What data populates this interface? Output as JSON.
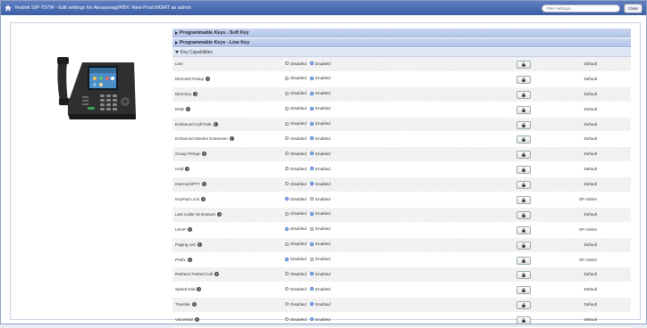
{
  "header": {
    "title": "Yealink SIP-T57W - Edit settings for Akrayanagi/PBX: New Prod MGMT as admin",
    "filter_placeholder": "Filter settings...",
    "clear_label": "Clear"
  },
  "sections": {
    "soft_key": "Programmable Keys - Soft Key",
    "line_key": "Programmable Keys - Line Key",
    "key_capabilities": "Key Capabilities"
  },
  "radio_labels": {
    "disabled": "Disabled",
    "enabled": "Enabled"
  },
  "rows": [
    {
      "name": "Line",
      "help": false,
      "selected": "enabled",
      "value": "Default"
    },
    {
      "name": "Directed Pickup",
      "help": true,
      "selected": "enabled",
      "value": "Default"
    },
    {
      "name": "Directory",
      "help": true,
      "selected": "enabled",
      "value": "Default"
    },
    {
      "name": "DND",
      "help": true,
      "selected": "enabled",
      "value": "Default"
    },
    {
      "name": "Enhanced Call Park",
      "help": true,
      "selected": "enabled",
      "value": "Default"
    },
    {
      "name": "Enhanced Monitor Extension",
      "help": true,
      "selected": "enabled",
      "value": "Default"
    },
    {
      "name": "Group Pickup",
      "help": true,
      "selected": "enabled",
      "value": "Default"
    },
    {
      "name": "Hold",
      "help": true,
      "selected": "enabled",
      "value": "Default"
    },
    {
      "name": "Intercom/PTT",
      "help": true,
      "selected": "enabled",
      "value": "Default"
    },
    {
      "name": "KeyPad Lock",
      "help": true,
      "selected": "disabled",
      "value": "SP Admin"
    },
    {
      "name": "Last Caller ID Erasure",
      "help": true,
      "selected": "enabled",
      "value": "Default"
    },
    {
      "name": "LDAP",
      "help": true,
      "selected": "disabled",
      "value": "SP Admin"
    },
    {
      "name": "Paging List",
      "help": true,
      "selected": "enabled",
      "value": "Default"
    },
    {
      "name": "Prefix",
      "help": true,
      "selected": "disabled",
      "value": "SP Admin"
    },
    {
      "name": "Retrieve Parked Call",
      "help": true,
      "selected": "enabled",
      "value": "Default"
    },
    {
      "name": "Speed Dial",
      "help": true,
      "selected": "enabled",
      "value": "Default"
    },
    {
      "name": "Transfer",
      "help": true,
      "selected": "enabled",
      "value": "Default"
    },
    {
      "name": "VoiceMail",
      "help": true,
      "selected": "enabled",
      "value": "Default"
    }
  ],
  "colors": {
    "header_bar": "#3b5ea6",
    "section_bar": "#b4c5e8",
    "radio_on": "#3a6fd0"
  }
}
